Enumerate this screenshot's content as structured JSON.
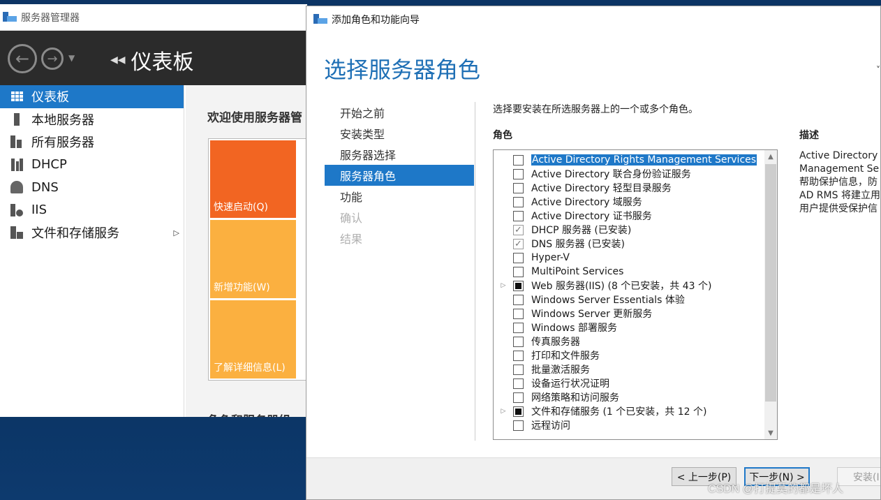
{
  "server_manager": {
    "title": "服务器管理器",
    "breadcrumb": "仪表板",
    "sidebar": [
      {
        "label": "仪表板",
        "icon": "dashboard-icon",
        "active": true
      },
      {
        "label": "本地服务器",
        "icon": "server-icon"
      },
      {
        "label": "所有服务器",
        "icon": "servers-icon"
      },
      {
        "label": "DHCP",
        "icon": "dhcp-icon"
      },
      {
        "label": "DNS",
        "icon": "dns-icon"
      },
      {
        "label": "IIS",
        "icon": "iis-icon"
      },
      {
        "label": "文件和存储服务",
        "icon": "storage-icon",
        "has_submenu": true
      }
    ],
    "welcome": "欢迎使用服务器管",
    "tiles": [
      "快速启动(Q)",
      "新增功能(W)",
      "了解详细信息(L)"
    ],
    "roles_heading": "角色和服务器组"
  },
  "wizard": {
    "title": "添加角色和功能向导",
    "heading": "选择服务器角色",
    "top_right": "˅",
    "steps": [
      {
        "label": "开始之前",
        "state": "normal"
      },
      {
        "label": "安装类型",
        "state": "normal"
      },
      {
        "label": "服务器选择",
        "state": "normal"
      },
      {
        "label": "服务器角色",
        "state": "active"
      },
      {
        "label": "功能",
        "state": "normal"
      },
      {
        "label": "确认",
        "state": "disabled"
      },
      {
        "label": "结果",
        "state": "disabled"
      }
    ],
    "instruction": "选择要安装在所选服务器上的一个或多个角色。",
    "roles_label": "角色",
    "description_label": "描述",
    "roles": [
      {
        "label": "Active Directory Rights Management Services",
        "state": "unchecked",
        "selected": true
      },
      {
        "label": "Active Directory 联合身份验证服务",
        "state": "unchecked"
      },
      {
        "label": "Active Directory 轻型目录服务",
        "state": "unchecked"
      },
      {
        "label": "Active Directory 域服务",
        "state": "unchecked"
      },
      {
        "label": "Active Directory 证书服务",
        "state": "unchecked"
      },
      {
        "label": "DHCP 服务器 (已安装)",
        "state": "checked"
      },
      {
        "label": "DNS 服务器 (已安装)",
        "state": "checked"
      },
      {
        "label": "Hyper-V",
        "state": "unchecked"
      },
      {
        "label": "MultiPoint Services",
        "state": "unchecked"
      },
      {
        "label": "Web 服务器(IIS) (8 个已安装，共 43 个)",
        "state": "partial",
        "expandable": true
      },
      {
        "label": "Windows Server Essentials 体验",
        "state": "unchecked"
      },
      {
        "label": "Windows Server 更新服务",
        "state": "unchecked"
      },
      {
        "label": "Windows 部署服务",
        "state": "unchecked"
      },
      {
        "label": "传真服务器",
        "state": "unchecked"
      },
      {
        "label": "打印和文件服务",
        "state": "unchecked"
      },
      {
        "label": "批量激活服务",
        "state": "unchecked"
      },
      {
        "label": "设备运行状况证明",
        "state": "unchecked"
      },
      {
        "label": "网络策略和访问服务",
        "state": "unchecked"
      },
      {
        "label": "文件和存储服务 (1 个已安装，共 12 个)",
        "state": "partial",
        "expandable": true
      },
      {
        "label": "远程访问",
        "state": "unchecked"
      }
    ],
    "description_lines": [
      "Active Directory",
      "Management Se",
      "帮助保护信息，防",
      "AD RMS 将建立用",
      "用户提供受保护信"
    ],
    "buttons": {
      "prev": "< 上一步(P)",
      "next": "下一步(N) >",
      "install": "安装(I"
    }
  },
  "watermark": "CSDN @打提莫的都是坏人"
}
